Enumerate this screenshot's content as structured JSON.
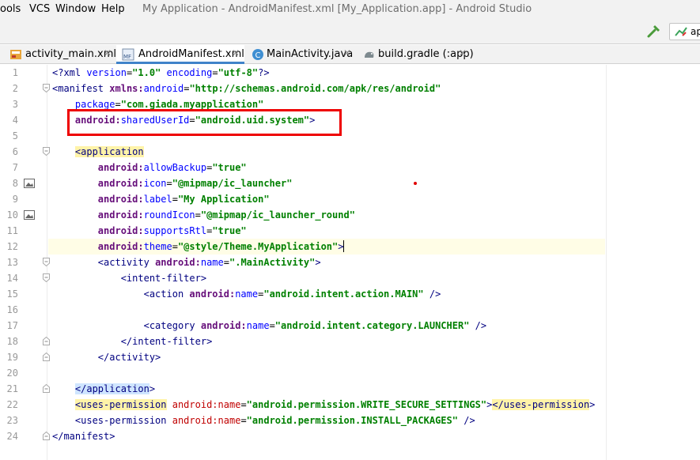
{
  "menu": {
    "items": [
      "ools",
      "VCS",
      "Window",
      "Help"
    ],
    "title": "My Application - AndroidManifest.xml [My_Application.app] - Android Studio"
  },
  "toolbar": {
    "build_icon": "hammer-icon",
    "run_config_label": "ap"
  },
  "tabs": [
    {
      "label": "activity_main.xml",
      "icon": "xml-layout-icon",
      "active": false
    },
    {
      "label": "AndroidManifest.xml",
      "icon": "manifest-icon",
      "active": true
    },
    {
      "label": "MainActivity.java",
      "icon": "java-class-icon",
      "active": false
    },
    {
      "label": "build.gradle (:app)",
      "icon": "gradle-icon",
      "active": false
    }
  ],
  "editor": {
    "line_numbers": [
      "1",
      "2",
      "3",
      "4",
      "5",
      "6",
      "7",
      "8",
      "9",
      "10",
      "11",
      "12",
      "13",
      "14",
      "15",
      "16",
      "17",
      "18",
      "19",
      "20",
      "21",
      "22",
      "23",
      "24"
    ],
    "lines": [
      "<?xml version=\"1.0\" encoding=\"utf-8\"?>",
      "<manifest xmlns:android=\"http://schemas.android.com/apk/res/android\"",
      "    package=\"com.giada.myapplication\"",
      "    android:sharedUserId=\"android.uid.system\">",
      "",
      "    <application",
      "        android:allowBackup=\"true\"",
      "        android:icon=\"@mipmap/ic_launcher\"",
      "        android:label=\"My Application\"",
      "        android:roundIcon=\"@mipmap/ic_launcher_round\"",
      "        android:supportsRtl=\"true\"",
      "        android:theme=\"@style/Theme.MyApplication\">",
      "        <activity android:name=\".MainActivity\">",
      "            <intent-filter>",
      "                <action android:name=\"android.intent.action.MAIN\" />",
      "",
      "                <category android:name=\"android.intent.category.LAUNCHER\" />",
      "            </intent-filter>",
      "        </activity>",
      "",
      "    </application>",
      "    <uses-permission android:name=\"android.permission.WRITE_SECURE_SETTINGS\"></uses-permission>",
      "    <uses-permission android:name=\"android.permission.INSTALL_PACKAGES\" />",
      "</manifest>"
    ],
    "gutter_icons": {
      "line_8": "image-icon",
      "line_10": "image-icon"
    }
  },
  "colors": {
    "highlight_box": "#ee0000",
    "tag": "#000080",
    "namespace": "#660e7a",
    "attribute": "#0000ff",
    "value": "#008000",
    "active_tab_underline": "#4083c9"
  }
}
